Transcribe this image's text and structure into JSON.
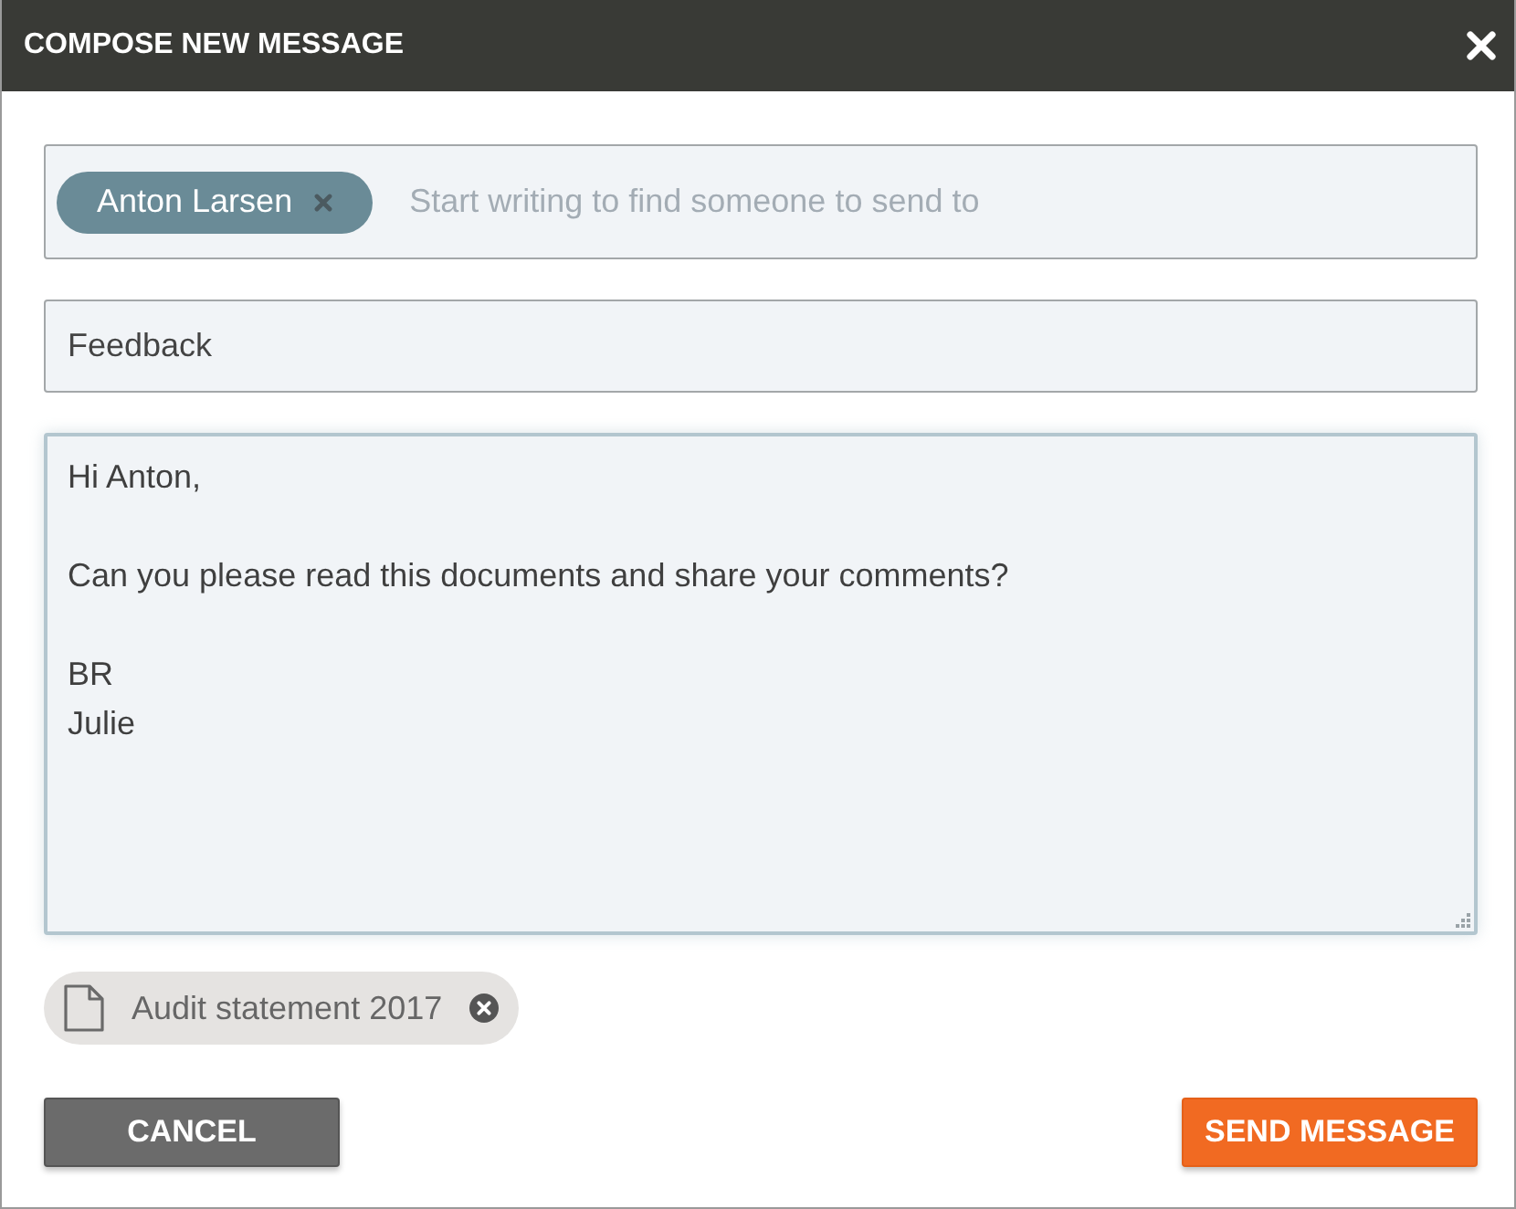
{
  "window": {
    "title": "COMPOSE NEW MESSAGE"
  },
  "recipients": {
    "chips": [
      {
        "name": "Anton Larsen"
      }
    ],
    "placeholder": "Start writing to find someone to send to"
  },
  "subject": {
    "value": "Feedback"
  },
  "message": {
    "body": "Hi Anton,\n\nCan you please read this documents and share your comments?\n\nBR\nJulie",
    "focused": true
  },
  "attachments": [
    {
      "name": "Audit statement 2017"
    }
  ],
  "buttons": [
    {
      "label": "CANCEL",
      "kind": "secondary"
    },
    {
      "label": "SEND MESSAGE",
      "kind": "primary"
    }
  ]
}
